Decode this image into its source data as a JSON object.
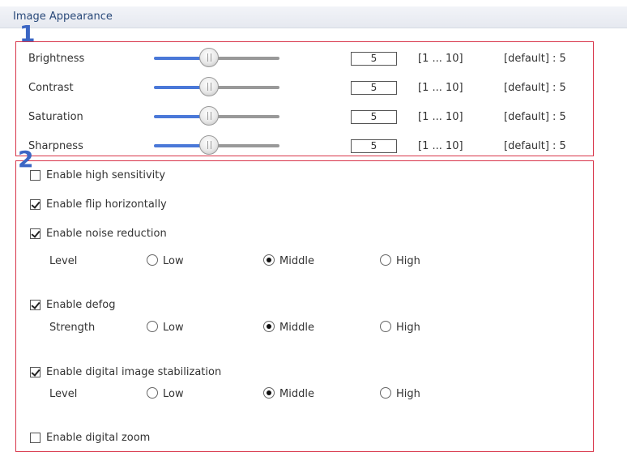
{
  "header": {
    "title": "Image Appearance"
  },
  "markers": {
    "one": "1",
    "two": "2"
  },
  "sliders": [
    {
      "label": "Brightness",
      "value": "5",
      "range": "[1 ... 10]",
      "default": "[default] : 5",
      "level": 0.44
    },
    {
      "label": "Contrast",
      "value": "5",
      "range": "[1 ... 10]",
      "default": "[default] : 5",
      "level": 0.44
    },
    {
      "label": "Saturation",
      "value": "5",
      "range": "[1 ... 10]",
      "default": "[default] : 5",
      "level": 0.44
    },
    {
      "label": "Sharpness",
      "value": "5",
      "range": "[1 ... 10]",
      "default": "[default] : 5",
      "level": 0.44
    }
  ],
  "options": {
    "high_sensitivity": {
      "label": "Enable high sensitivity",
      "checked": false
    },
    "flip_horizontally": {
      "label": "Enable flip horizontally",
      "checked": true
    },
    "noise_reduction": {
      "label": "Enable noise reduction",
      "checked": true,
      "sub_label": "Level",
      "choices": [
        "Low",
        "Middle",
        "High"
      ],
      "selected": "Middle"
    },
    "defog": {
      "label": "Enable defog",
      "checked": true,
      "sub_label": "Strength",
      "choices": [
        "Low",
        "Middle",
        "High"
      ],
      "selected": "Middle"
    },
    "stabilization": {
      "label": "Enable digital image stabilization",
      "checked": true,
      "sub_label": "Level",
      "choices": [
        "Low",
        "Middle",
        "High"
      ],
      "selected": "Middle"
    },
    "digital_zoom": {
      "label": "Enable digital zoom",
      "checked": false
    }
  },
  "colors": {
    "accent": "#4a78d8",
    "highlight_box": "#d8354a",
    "marker": "#3b66c4"
  }
}
